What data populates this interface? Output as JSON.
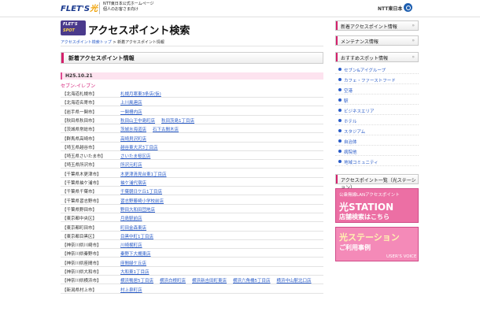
{
  "header": {
    "logo": "FLET'S",
    "logo_hikari": "光",
    "tagline_1": "NTT東日本公式ホームページ",
    "tagline_2": "個人のお客さま向け",
    "ntt": "NTT東日本"
  },
  "spot_logo": {
    "line1": "FLET'S",
    "line2": "SPOT"
  },
  "page_title": "アクセスポイント検索",
  "breadcrumb": {
    "home": "アクセスポイント検索トップ",
    "sep": ">",
    "current": "新着アクセスポイント情報"
  },
  "section_title": "新着アクセスポイント情報",
  "date": "H25.10.21",
  "group": "セブン-イレブン",
  "rows": [
    {
      "pref": "【北海道札幌市】",
      "links": [
        "札幌月寒東3条店(仮)"
      ]
    },
    {
      "pref": "【北海道名寄市】",
      "links": [
        "上川風連店"
      ]
    },
    {
      "pref": "【岩手県一関市】",
      "links": [
        "一関柵内店"
      ]
    },
    {
      "pref": "【秋田県秋田市】",
      "links": [
        "秋田山王中島町店",
        "秋田茨島1丁目店"
      ]
    },
    {
      "pref": "【茨城県常総市】",
      "links": [
        "茨城水海道店",
        "石下古間木店"
      ]
    },
    {
      "pref": "【群馬県高崎市】",
      "links": [
        "高崎貝沢町店"
      ]
    },
    {
      "pref": "【埼玉県越谷市】",
      "links": [
        "越谷東大沢3丁目店"
      ]
    },
    {
      "pref": "【埼玉県さいたま市】",
      "links": [
        "さいたま桜区店"
      ]
    },
    {
      "pref": "【埼玉県所沢市】",
      "links": [
        "所沢元町店"
      ]
    },
    {
      "pref": "【千葉県木更津市】",
      "links": [
        "木更津清見台東1丁目店"
      ]
    },
    {
      "pref": "【千葉県袖ケ浦市】",
      "links": [
        "袖ケ浦代宿店"
      ]
    },
    {
      "pref": "【千葉県千葉市】",
      "links": [
        "千葉朝日ケ丘1丁目店"
      ]
    },
    {
      "pref": "【千葉県習志野市】",
      "links": [
        "習志野藤崎小学校前店"
      ]
    },
    {
      "pref": "【千葉県野田市】",
      "links": [
        "野田大和田団地店"
      ]
    },
    {
      "pref": "【東京都中央区】",
      "links": [
        "月島駅前店"
      ]
    },
    {
      "pref": "【東京都町田市】",
      "links": [
        "町田金森東店"
      ]
    },
    {
      "pref": "【東京都目黒区】",
      "links": [
        "目黒中町1丁目店"
      ]
    },
    {
      "pref": "【神奈川県川崎市】",
      "links": [
        "川崎梶町店"
      ]
    },
    {
      "pref": "【神奈川県秦野市】",
      "links": [
        "秦野下大槻東店"
      ]
    },
    {
      "pref": "【神奈川県座間市】",
      "links": [
        "座間緑ケ丘店"
      ]
    },
    {
      "pref": "【神奈川県大和市】",
      "links": [
        "大和東1丁目店"
      ]
    },
    {
      "pref": "【神奈川県横浜市】",
      "links": [
        "横浜鴨居5丁目店",
        "横浜白根町店",
        "横浜新吉田町東店",
        "横浜六角橋5丁目店",
        "横浜中山駅北口店"
      ]
    },
    {
      "pref": "【新潟県村上市】",
      "links": [
        "村上泉町店"
      ]
    }
  ],
  "sidebar": {
    "heads": [
      "新着アクセスポイント情報",
      "メンテナンス情報",
      "おすすめスポット情報"
    ],
    "arrow": "»",
    "items": [
      "セブン&アイグループ",
      "カフェ・ファーストフード",
      "空港",
      "駅",
      "ビジネスエリア",
      "ホテル",
      "スタジアム",
      "自治体",
      "病院他",
      "地域コミュニティ"
    ],
    "list_head": "アクセスポイント一覧（光ステーション）",
    "banner1": {
      "t1": "公衆無線LANアクセスポイント",
      "t2": "光STATION",
      "t3": "店舗検索はこちら"
    },
    "banner2": {
      "t1": "光ステーション",
      "t2": "ご利用事例",
      "t3": "USER'S VOICE"
    }
  }
}
